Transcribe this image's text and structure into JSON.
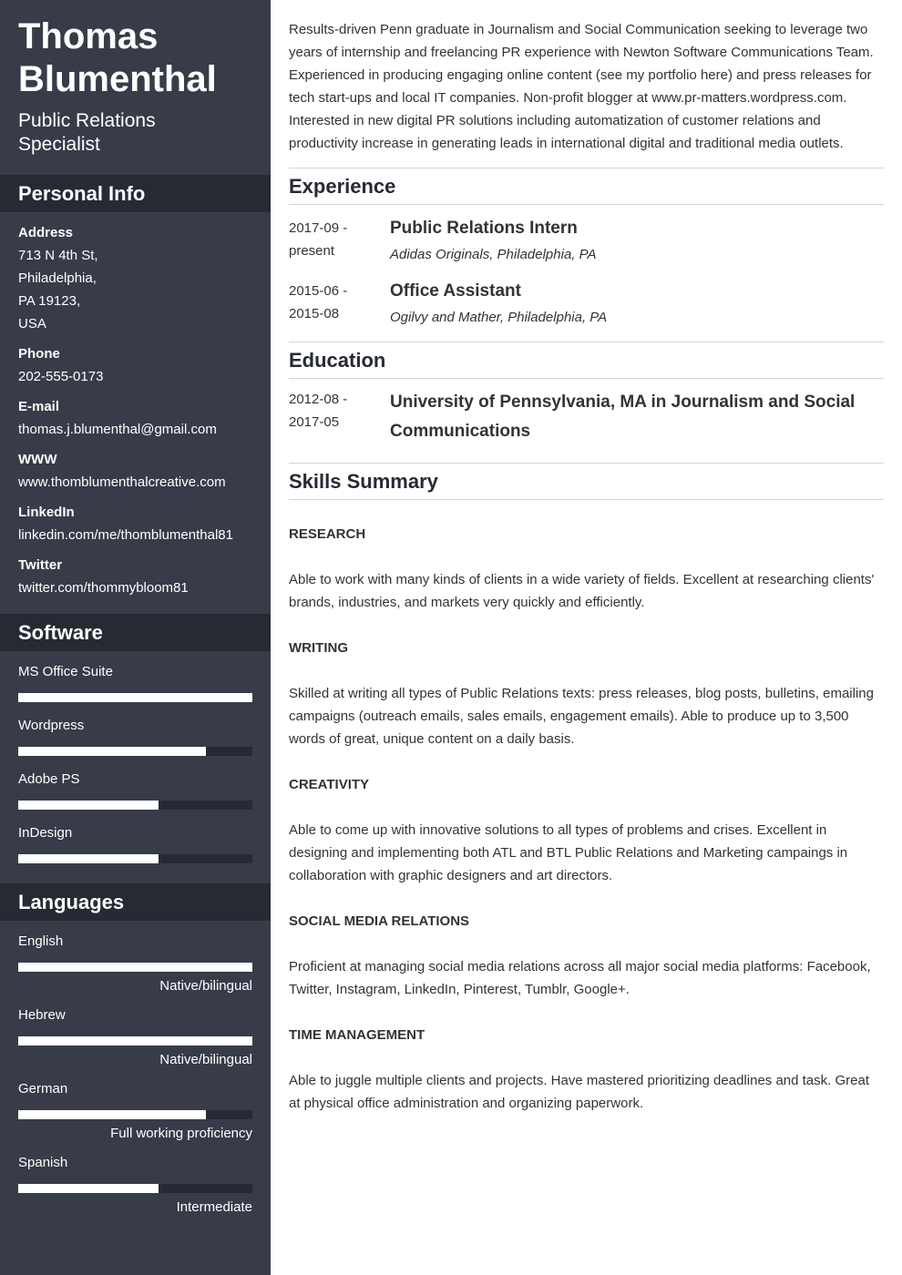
{
  "header": {
    "first_name": "Thomas",
    "last_name": "Blumenthal",
    "title_line1": "Public Relations",
    "title_line2": "Specialist"
  },
  "personal_info": {
    "heading": "Personal Info",
    "address_label": "Address",
    "address_lines": [
      "713 N 4th St,",
      "Philadelphia,",
      "PA 19123,",
      "USA"
    ],
    "phone_label": "Phone",
    "phone": "202-555-0173",
    "email_label": "E-mail",
    "email": "thomas.j.blumenthal@gmail.com",
    "www_label": "WWW",
    "www": "www.thomblumenthalcreative.com",
    "linkedin_label": "LinkedIn",
    "linkedin": "linkedin.com/me/thomblumenthal81",
    "twitter_label": "Twitter",
    "twitter": "twitter.com/thommybloom81"
  },
  "software": {
    "heading": "Software",
    "items": [
      {
        "label": "MS Office Suite",
        "level_pct": 100
      },
      {
        "label": "Wordpress",
        "level_pct": 80
      },
      {
        "label": "Adobe PS",
        "level_pct": 60
      },
      {
        "label": "InDesign",
        "level_pct": 60
      }
    ]
  },
  "languages": {
    "heading": "Languages",
    "items": [
      {
        "label": "English",
        "level_pct": 100,
        "level_text": "Native/bilingual"
      },
      {
        "label": "Hebrew",
        "level_pct": 100,
        "level_text": "Native/bilingual"
      },
      {
        "label": "German",
        "level_pct": 80,
        "level_text": "Full working proficiency"
      },
      {
        "label": "Spanish",
        "level_pct": 60,
        "level_text": "Intermediate"
      }
    ]
  },
  "summary": "Results-driven Penn graduate in Journalism and Social Communication seeking to leverage two years of internship and freelancing PR experience with Newton Software Communications Team. Experienced in producing engaging online content (see my portfolio here) and press releases for tech start-ups and local IT companies. Non-profit blogger at www.pr-matters.wordpress.com. Interested in new digital PR solutions including automatization of customer relations and productivity increase in generating leads in international digital and traditional media outlets.",
  "experience": {
    "heading": "Experience",
    "items": [
      {
        "date_start": "2017-09 -",
        "date_end": "present",
        "title": "Public Relations Intern",
        "company": "Adidas Originals, Philadelphia, PA"
      },
      {
        "date_start": "2015-06 -",
        "date_end": "2015-08",
        "title": "Office Assistant",
        "company": "Ogilvy and Mather, Philadelphia, PA"
      }
    ]
  },
  "education": {
    "heading": "Education",
    "items": [
      {
        "date_start": "2012-08 -",
        "date_end": "2017-05",
        "title": "University of Pennsylvania, MA in Journalism and Social Communications"
      }
    ]
  },
  "skills_summary": {
    "heading": "Skills Summary",
    "items": [
      {
        "name": "RESEARCH",
        "description": "Able to work with many kinds of clients in a wide variety of fields. Excellent at researching clients' brands, industries, and markets very quickly and efficiently."
      },
      {
        "name": "WRITING",
        "description": "Skilled at writing all types of Public Relations texts: press releases, blog posts, bulletins, emailing campaigns (outreach emails, sales emails, engagement emails). Able to produce up to 3,500 words of great, unique content on a daily basis."
      },
      {
        "name": "CREATIVITY",
        "description": "Able to come up with innovative solutions to all types of problems and crises. Excellent in designing and implementing both ATL and BTL Public Relations and Marketing campaings in collaboration with graphic designers and art directors."
      },
      {
        "name": "SOCIAL MEDIA RELATIONS",
        "description": "Proficient at managing social media relations across all major social media platforms: Facebook, Twitter, Instagram, LinkedIn, Pinterest, Tumblr, Google+."
      },
      {
        "name": "TIME MANAGEMENT",
        "description": "Able to juggle multiple clients and projects. Have mastered prioritizing deadlines and task. Great at physical office administration and organizing paperwork."
      }
    ]
  },
  "colors": {
    "sidebar_bg": "#383c48",
    "sidebar_header_bg": "#262a33",
    "text_dark": "#333333",
    "bar_fill": "#ffffff"
  }
}
